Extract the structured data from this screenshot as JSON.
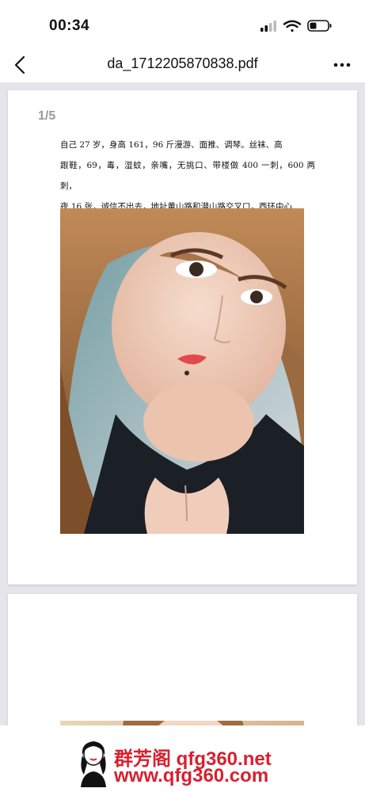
{
  "status_bar": {
    "time": "00:34"
  },
  "nav_bar": {
    "title": "da_1712205870838.pdf",
    "back_icon": "chevron-left-icon",
    "more_icon": "more-horizontal-icon"
  },
  "document": {
    "page_indicator": "1/5",
    "text_lines": [
      "自己 27 岁，身高 161，96 斤漫游、面推、调琴。丝袜、高",
      "跟鞋，69，毒，湿蚊，亲嘴，无挑口、带楼做 400 一刺，600 两刺，",
      "夜 16 张，诚信不出去，地址黄山路和潜山路交叉口，西环中心"
    ]
  },
  "watermark": {
    "line1_cn": "群芳阁",
    "line1_domain": "qfg360.net",
    "line2": "www.qfg360.com"
  },
  "colors": {
    "watermark_red": "#d8202f",
    "page_bg": "#ffffff",
    "viewer_bg": "#e6e6ea"
  }
}
